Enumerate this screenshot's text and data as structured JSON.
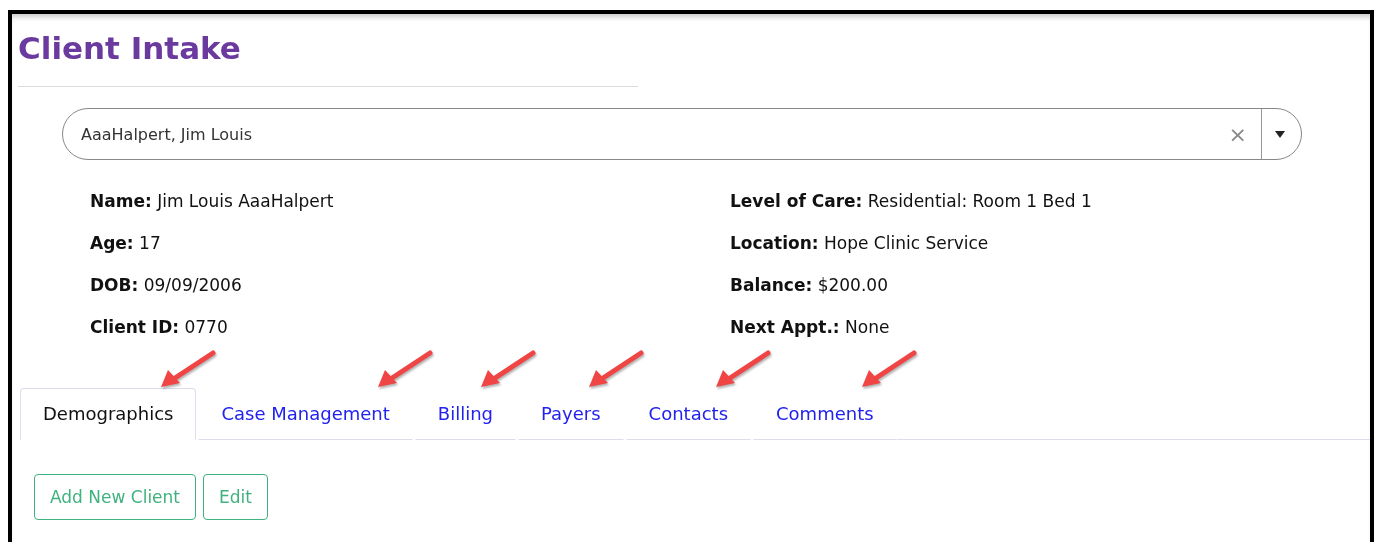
{
  "title": "Client Intake",
  "client_search": {
    "value": "AaaHalpert, Jim Louis",
    "clear": "×"
  },
  "details_left": [
    {
      "label": "Name:",
      "value": "Jim Louis AaaHalpert"
    },
    {
      "label": "Age:",
      "value": "17"
    },
    {
      "label": "DOB:",
      "value": "09/09/2006"
    },
    {
      "label": "Client ID:",
      "value": "0770"
    }
  ],
  "details_right": [
    {
      "label": "Level of Care:",
      "value": "Residential: Room 1 Bed 1"
    },
    {
      "label": "Location:",
      "value": "Hope Clinic Service"
    },
    {
      "label": "Balance:",
      "value": "$200.00"
    },
    {
      "label": "Next Appt.:",
      "value": "None"
    }
  ],
  "tabs": [
    {
      "label": "Demographics",
      "selected": true,
      "marked": true
    },
    {
      "label": "Case Management",
      "selected": false,
      "marked": true
    },
    {
      "label": "Billing",
      "selected": false,
      "marked": true
    },
    {
      "label": "Payers",
      "selected": false,
      "marked": true
    },
    {
      "label": "Contacts",
      "selected": false,
      "marked": true
    },
    {
      "label": "Comments",
      "selected": false,
      "marked": true
    }
  ],
  "buttons": [
    "Add New Client",
    "Edit"
  ]
}
